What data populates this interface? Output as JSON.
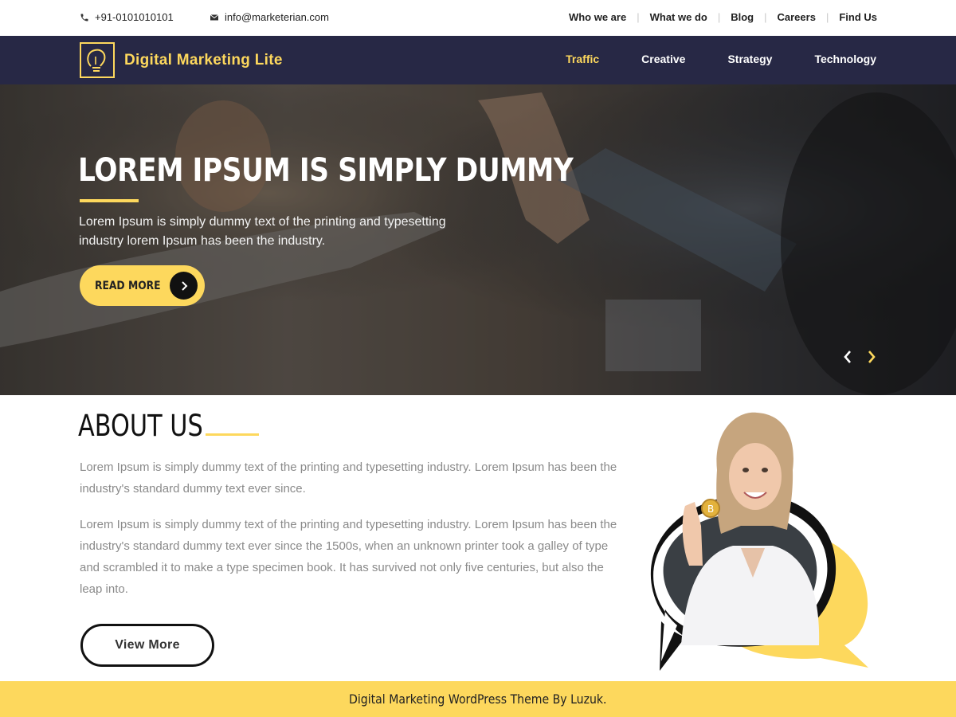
{
  "topbar": {
    "phone": "+91-0101010101",
    "email": "info@marketerian.com",
    "links": [
      "Who we are",
      "What we do",
      "Blog",
      "Careers",
      "Find Us"
    ]
  },
  "header": {
    "logo_text": "Digital Marketing Lite",
    "nav": [
      {
        "label": "Traffic",
        "active": true
      },
      {
        "label": "Creative",
        "active": false
      },
      {
        "label": "Strategy",
        "active": false
      },
      {
        "label": "Technology",
        "active": false
      }
    ]
  },
  "hero": {
    "title": "LOREM IPSUM IS SIMPLY DUMMY",
    "text": "Lorem Ipsum is simply dummy text of the printing and typesetting industry lorem Ipsum has been the industry.",
    "button_label": "READ MORE"
  },
  "about": {
    "title": "ABOUT US",
    "paragraph1": "Lorem Ipsum is simply dummy text of the printing and typesetting industry. Lorem Ipsum has been the industry's standard dummy text ever since.",
    "paragraph2": "Lorem Ipsum is simply dummy text of the printing and typesetting industry. Lorem Ipsum has been the industry's standard dummy text ever since the 1500s, when an unknown printer took a galley of type and scrambled it to make a type specimen book. It has survived not only five centuries, but also the leap into.",
    "button_label": "View More"
  },
  "footer": {
    "text": "Digital Marketing WordPress Theme By Luzuk."
  },
  "colors": {
    "accent": "#fdd85d",
    "nav_bg": "#272845"
  },
  "icons": {
    "phone": "phone-icon",
    "email": "envelope-icon",
    "logo": "lightbulb-icon",
    "readmore": "chevron-right-icon",
    "prev": "chevron-left-icon",
    "next": "chevron-right-icon"
  }
}
